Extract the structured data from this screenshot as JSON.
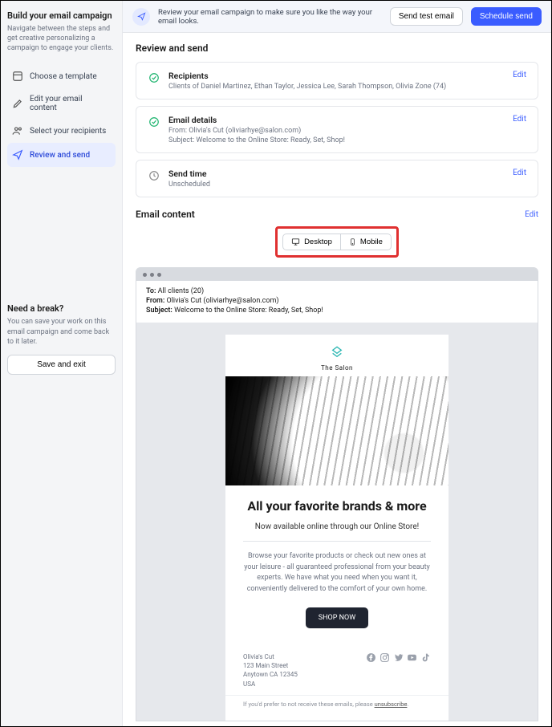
{
  "sidebar": {
    "title": "Build your email campaign",
    "subtitle": "Navigate between the steps and get creative personalizing a campaign to engage your clients.",
    "steps": [
      {
        "label": "Choose a template"
      },
      {
        "label": "Edit your email content"
      },
      {
        "label": "Select your recipients"
      },
      {
        "label": "Review and send"
      }
    ],
    "break_title": "Need a break?",
    "break_sub": "You can save your work on this email campaign and come back to it later.",
    "save_exit": "Save and exit"
  },
  "topbar": {
    "message": "Review your email campaign to make sure you like the way your email looks.",
    "send_test": "Send test email",
    "schedule": "Schedule send"
  },
  "section_title": "Review and send",
  "cards": {
    "edit": "Edit",
    "recipients": {
      "title": "Recipients",
      "sub": "Clients of Daniel Martinez, Ethan Taylor, Jessica Lee, Sarah Thompson, Olivia Zone (74)"
    },
    "details": {
      "title": "Email details",
      "from": "From: Olivia's Cut (oliviarhye@salon.com)",
      "subject": "Subject: Welcome to the Online Store: Ready, Set, Shop!"
    },
    "sendtime": {
      "title": "Send time",
      "sub": "Unscheduled"
    }
  },
  "email_content_label": "Email content",
  "toggle": {
    "desktop": "Desktop",
    "mobile": "Mobile"
  },
  "preview": {
    "to_label": "To:",
    "to_value": "All clients (20)",
    "from_label": "From:",
    "from_value": "Olivia's Cut (oliviarhye@salon.com)",
    "subject_label": "Subject:",
    "subject_value": "Welcome to the Online Store: Ready, Set, Shop!",
    "logo_name": "The Salon",
    "headline": "All your favorite brands & more",
    "subhead": "Now available online through our Online Store!",
    "body": "Browse your favorite products or check out new ones at your leisure - all guaranteed professional from your beauty experts. We have what you need when you want it, conveniently delivered to the comfort of your own home.",
    "cta": "SHOP NOW",
    "address": {
      "name": "Olivia's Cut",
      "line1": "123 Main Street",
      "line2": "Anytown CA 12345",
      "country": "USA"
    },
    "unsub_prefix": "If you'd prefer to not receive these emails, please ",
    "unsub_link": "unsubscribe"
  }
}
